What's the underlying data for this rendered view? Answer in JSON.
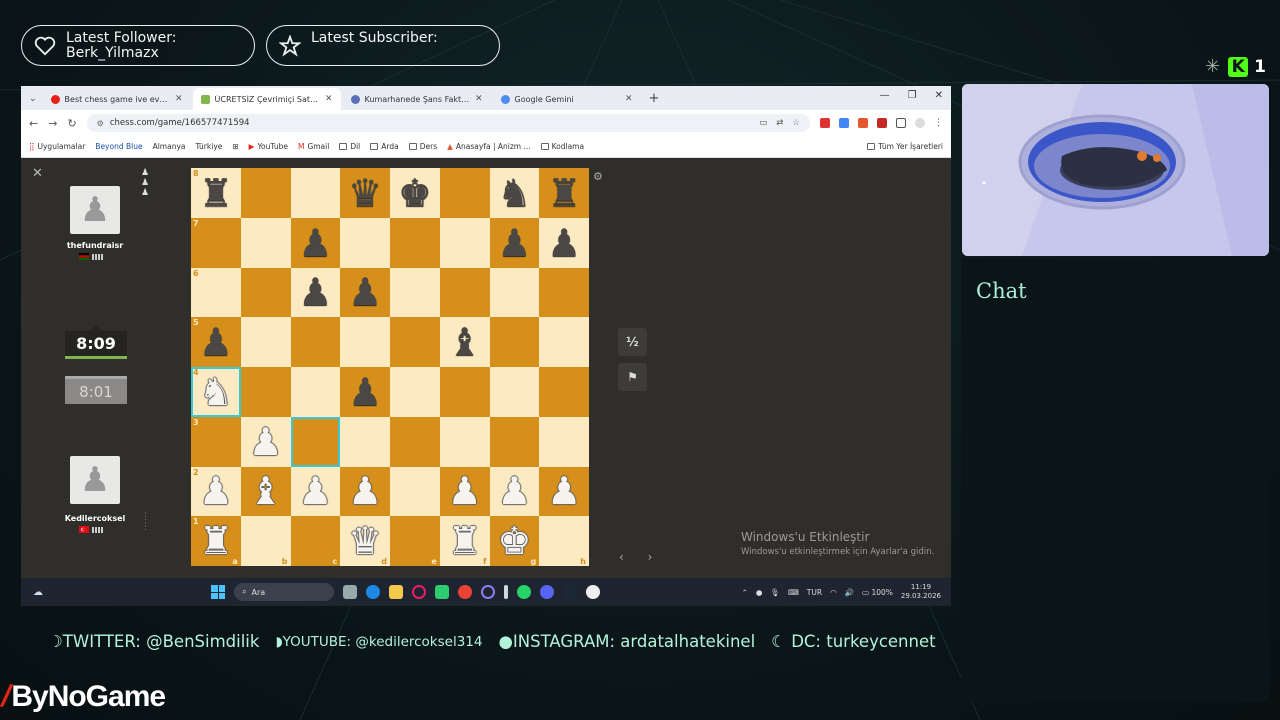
{
  "overlay": {
    "follower": {
      "label": "Latest Follower:",
      "value": "Berk_Yilmazx",
      "icon": "heart-icon"
    },
    "subscriber": {
      "label": "Latest Subscriber:",
      "value": "",
      "icon": "star-icon"
    },
    "kick": {
      "badge": "K",
      "viewers": "1",
      "brand_color": "#53fc18"
    },
    "chat_title": "Chat",
    "socials": [
      "TWITTER: @BenSimdilik",
      "YOUTUBE: @kedilercoksel314",
      "INSTAGRAM: ardatalhatekinel",
      "DC: turkeycennet"
    ],
    "sponsor_logo": "ByNoGame"
  },
  "browser": {
    "tabs": [
      {
        "title": "Best chess game ive ever played",
        "icon": "youtube-icon",
        "active": false
      },
      {
        "title": "ÜCRETSİZ Çevrimiçi Satranç",
        "icon": "chess-icon",
        "active": true
      },
      {
        "title": "Kumarhanede Şans Faktörü: Oy",
        "icon": "web-icon",
        "active": false
      },
      {
        "title": "Google Gemini",
        "icon": "gemini-icon",
        "active": false
      }
    ],
    "url": "chess.com/game/166577471594",
    "bookmarks": [
      "Uygulamalar",
      "Beyond Blue",
      "Almanya",
      "Türkiye",
      "YouTube",
      "Gmail",
      "Dil",
      "Arda",
      "Ders",
      "Anasayfa | Anizm ...",
      "Kodlama"
    ],
    "other_bookmarks": "Tüm Yer İşaretleri"
  },
  "game": {
    "top_player": {
      "name": "thefundraisr",
      "clock": "8:09",
      "captured": [
        "♟",
        "♟",
        "♟"
      ]
    },
    "bottom_player": {
      "name": "Kedilercoksel",
      "clock": "8:01"
    },
    "draw_label": "½",
    "flag_label": "⚑",
    "move_nav": "‹ ›",
    "files": [
      "a",
      "b",
      "c",
      "d",
      "e",
      "f",
      "g",
      "h"
    ],
    "ranks": [
      "8",
      "7",
      "6",
      "5",
      "4",
      "3",
      "2",
      "1"
    ],
    "board": [
      [
        "r",
        "",
        "",
        "q",
        "k",
        "",
        "n",
        "r"
      ],
      [
        "",
        "",
        "p",
        "",
        "",
        "",
        "p",
        "p"
      ],
      [
        "",
        "",
        "p",
        "p",
        "",
        "",
        "",
        ""
      ],
      [
        "p",
        "",
        "",
        "",
        "",
        "b",
        "",
        ""
      ],
      [
        "N",
        "",
        "",
        "p",
        "",
        "",
        "",
        ""
      ],
      [
        "",
        "P",
        "",
        "",
        "",
        "",
        "",
        ""
      ],
      [
        "P",
        "B",
        "P",
        "P",
        "",
        "P",
        "P",
        "P"
      ],
      [
        "R",
        "",
        "",
        "Q",
        "",
        "R",
        "K",
        ""
      ]
    ],
    "highlight": [
      "a4",
      "c3"
    ]
  },
  "windows": {
    "activate_title": "Windows'u Etkinleştir",
    "activate_sub": "Windows'u etkinleştirmek için Ayarlar'a gidin.",
    "search_placeholder": "Ara",
    "lang": "TUR",
    "battery": "100%",
    "time": "11:19",
    "date": "29.03.2026"
  }
}
